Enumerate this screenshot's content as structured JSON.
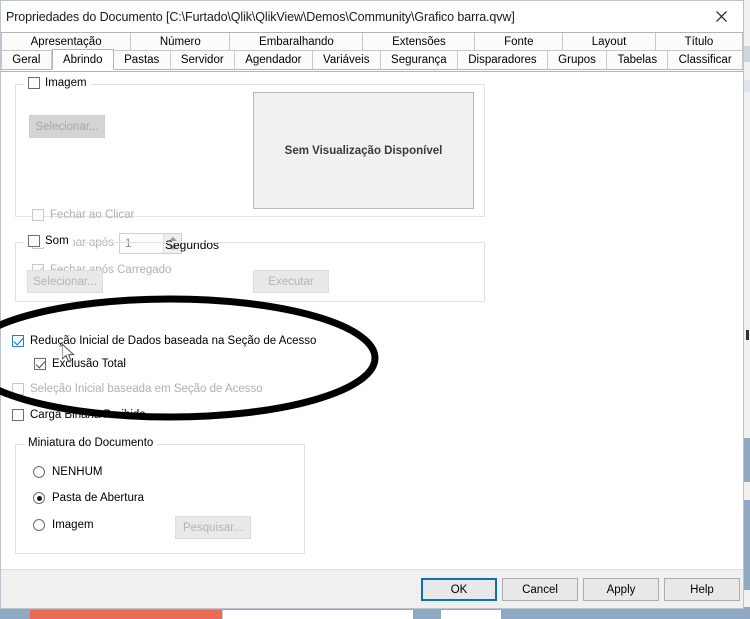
{
  "window": {
    "title": "Propriedades do Documento [C:\\Furtado\\Qlik\\QlikView\\Demos\\Community\\Grafico barra.qvw]",
    "close_label": "✕"
  },
  "tabs": {
    "row1": [
      {
        "label": "Apresentação",
        "active": false
      },
      {
        "label": "Número",
        "active": false
      },
      {
        "label": "Embaralhando",
        "active": false
      },
      {
        "label": "Extensões",
        "active": false
      },
      {
        "label": "Fonte",
        "active": false
      },
      {
        "label": "Layout",
        "active": false
      },
      {
        "label": "Título",
        "active": false
      }
    ],
    "row2": [
      {
        "label": "Geral",
        "active": false
      },
      {
        "label": "Abrindo",
        "active": true
      },
      {
        "label": "Pastas",
        "active": false
      },
      {
        "label": "Servidor",
        "active": false
      },
      {
        "label": "Agendador",
        "active": false
      },
      {
        "label": "Variáveis",
        "active": false
      },
      {
        "label": "Segurança",
        "active": false
      },
      {
        "label": "Disparadores",
        "active": false
      },
      {
        "label": "Grupos",
        "active": false
      },
      {
        "label": "Tabelas",
        "active": false
      },
      {
        "label": "Classificar",
        "active": false
      }
    ]
  },
  "image_group": {
    "legend": "Imagem",
    "checked": false,
    "select_button": "Selecionar...",
    "close_on_click": {
      "label": "Fechar ao Clicar",
      "checked": false,
      "disabled": true
    },
    "close_after": {
      "label": "Fechar após",
      "checked": false,
      "disabled": true
    },
    "seconds_value": "1",
    "seconds_label": "Segundos",
    "close_after_loaded": {
      "label": "Fechar após Carregado",
      "checked": true,
      "disabled": true
    },
    "preview_text": "Sem Visualização Disponível"
  },
  "sound_group": {
    "legend": "Som",
    "checked": false,
    "select_button": "Selecionar...",
    "play_button": "Executar"
  },
  "security_options": [
    {
      "label": "Redução Inicial de Dados baseada na Seção de Acesso",
      "checked": true,
      "disabled": false,
      "indent": 0
    },
    {
      "label": "Exclusão Total",
      "checked": true,
      "disabled": false,
      "indent": 1
    },
    {
      "label": "Seleção Inicial baseada em Seção de Acesso",
      "checked": false,
      "disabled": true,
      "indent": 0
    },
    {
      "label": "Carga Binária Proibida",
      "checked": false,
      "disabled": false,
      "indent": 0
    }
  ],
  "thumbnail_group": {
    "legend": "Miniatura do Documento",
    "options": [
      {
        "label": "NENHUM",
        "selected": false
      },
      {
        "label": "Pasta de Abertura",
        "selected": true
      },
      {
        "label": "Imagem",
        "selected": false
      }
    ],
    "browse_button": "Pesquisar..."
  },
  "footer": {
    "ok": "OK",
    "cancel": "Cancel",
    "apply": "Apply",
    "help": "Help"
  },
  "annotation": {
    "shape": "ellipse",
    "color": "#000000",
    "stroke_width": 7
  },
  "cursor": {
    "type": "arrow-pointer"
  }
}
